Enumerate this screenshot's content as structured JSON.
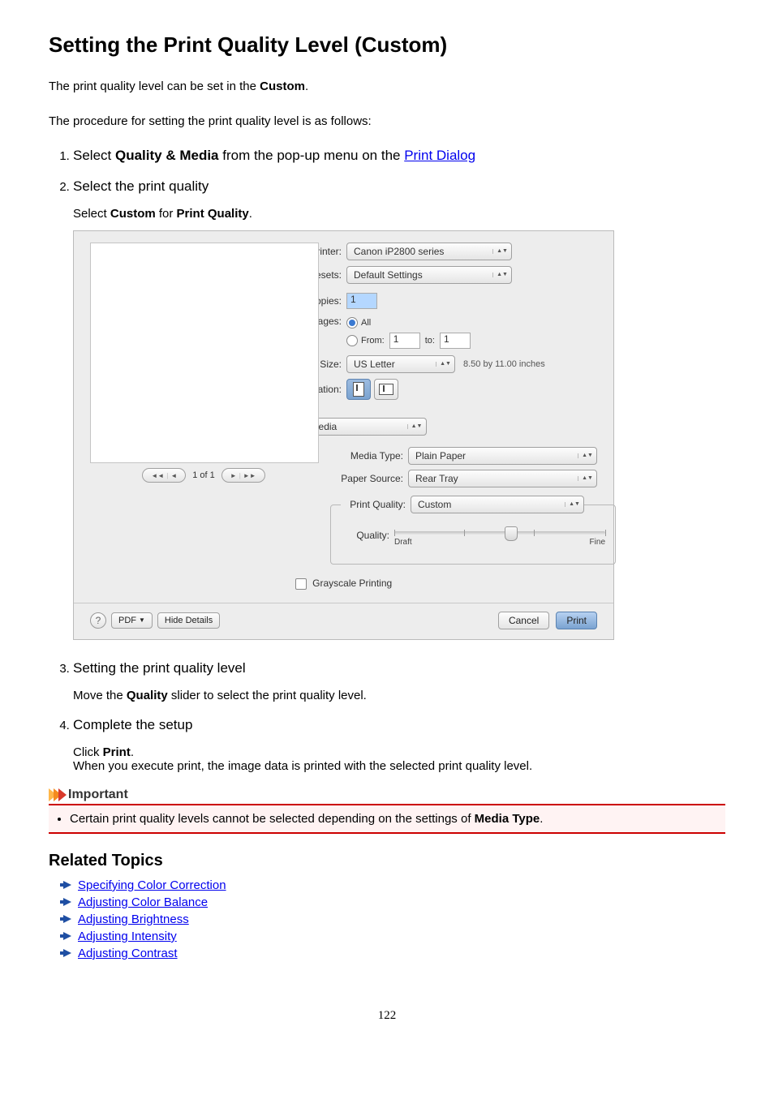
{
  "heading": "Setting the Print Quality Level (Custom)",
  "intro1_pre": "The print quality level can be set in the ",
  "intro1_bold": "Custom",
  "intro1_post": ".",
  "intro2": "The procedure for setting the print quality level is as follows:",
  "steps": {
    "s1_pre": "Select ",
    "s1_bold": "Quality & Media",
    "s1_mid": " from the pop-up menu on the ",
    "s1_link": "Print Dialog",
    "s2_title": "Select the print quality",
    "s2_sub_pre": "Select ",
    "s2_sub_b1": "Custom",
    "s2_sub_mid": " for ",
    "s2_sub_b2": "Print Quality",
    "s2_sub_post": ".",
    "s3_title": "Setting the print quality level",
    "s3_sub_pre": "Move the ",
    "s3_sub_b": "Quality",
    "s3_sub_post": " slider to select the print quality level.",
    "s4_title": "Complete the setup",
    "s4_line1_pre": "Click ",
    "s4_line1_b": "Print",
    "s4_line1_post": ".",
    "s4_line2": "When you execute print, the image data is printed with the selected print quality level."
  },
  "dialog": {
    "printer_lbl": "Printer:",
    "printer_val": "Canon iP2800 series",
    "presets_lbl": "Presets:",
    "presets_val": "Default Settings",
    "copies_lbl": "Copies:",
    "copies_val": "1",
    "pages_lbl": "Pages:",
    "pages_all": "All",
    "pages_from": "From:",
    "pages_from_val": "1",
    "pages_to": "to:",
    "pages_to_val": "1",
    "papersize_lbl": "Paper Size:",
    "papersize_val": "US Letter",
    "papersize_dim": "8.50 by 11.00 inches",
    "orientation_lbl": "Orientation:",
    "popup_val": "Quality & Media",
    "mediatype_lbl": "Media Type:",
    "mediatype_val": "Plain Paper",
    "papersource_lbl": "Paper Source:",
    "papersource_val": "Rear Tray",
    "printquality_lbl": "Print Quality:",
    "printquality_val": "Custom",
    "quality_lbl": "Quality:",
    "quality_min": "Draft",
    "quality_max": "Fine",
    "grayscale": "Grayscale Printing",
    "pager_text": "1 of 1",
    "help": "?",
    "pdf": "PDF",
    "hide": "Hide Details",
    "cancel": "Cancel",
    "print": "Print"
  },
  "important_head": "Important",
  "important_item_pre": "Certain print quality levels cannot be selected depending on the settings of ",
  "important_item_b": "Media Type",
  "important_item_post": ".",
  "related_head": "Related Topics",
  "related": {
    "r1": "Specifying Color Correction",
    "r2": "Adjusting Color Balance",
    "r3": "Adjusting Brightness",
    "r4": "Adjusting Intensity",
    "r5": "Adjusting Contrast"
  },
  "page_number": "122"
}
